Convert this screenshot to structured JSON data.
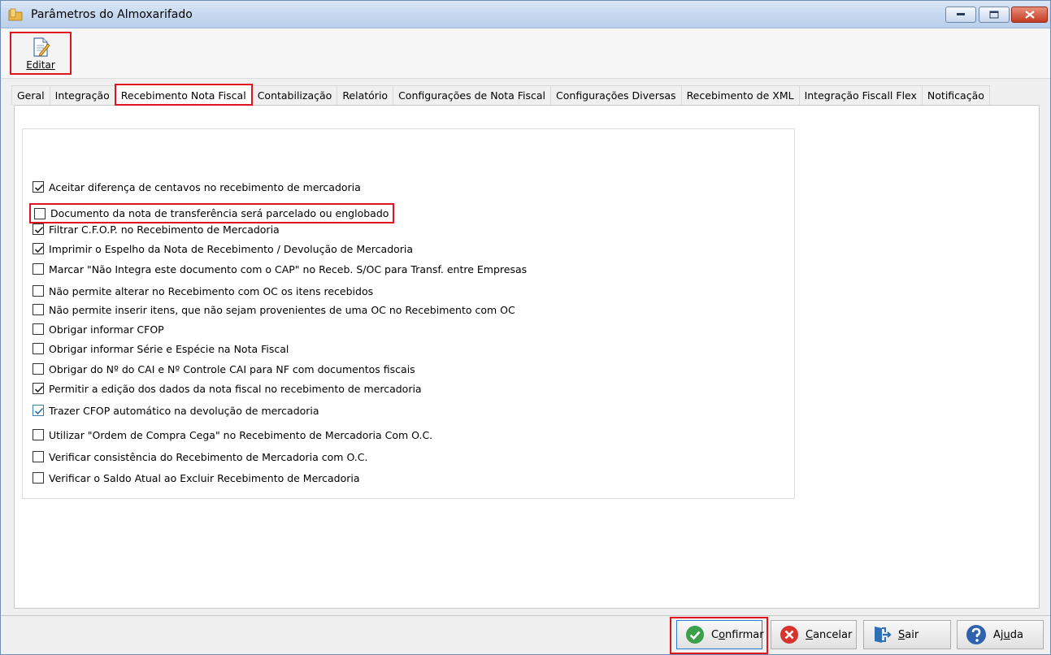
{
  "window": {
    "title": "Parâmetros do Almoxarifado",
    "icon": "folder-icon"
  },
  "toolbar": {
    "edit_label": "Editar",
    "edit_icon": "edit-document-icon"
  },
  "tabs": [
    {
      "label": "Geral",
      "active": false
    },
    {
      "label": "Integração",
      "active": false
    },
    {
      "label": "Recebimento Nota Fiscal",
      "active": true
    },
    {
      "label": "Contabilização",
      "active": false
    },
    {
      "label": "Relatório",
      "active": false
    },
    {
      "label": "Configurações de Nota Fiscal",
      "active": false
    },
    {
      "label": "Configurações Diversas",
      "active": false
    },
    {
      "label": "Recebimento de XML",
      "active": false
    },
    {
      "label": "Integração Fiscall Flex",
      "active": false
    },
    {
      "label": "Notificação",
      "active": false
    }
  ],
  "options": [
    {
      "label": "Aceitar diferença de centavos no recebimento de mercadoria",
      "checked": true
    },
    {
      "label": "Documento da nota de transferência será parcelado ou englobado",
      "checked": false,
      "highlighted": true
    },
    {
      "label": "Filtrar C.F.O.P. no Recebimento de Mercadoria",
      "checked": true
    },
    {
      "label": "Imprimir o Espelho da Nota de Recebimento / Devolução de Mercadoria",
      "checked": true
    },
    {
      "label": "Marcar \"Não Integra este documento com o CAP\" no Receb. S/OC para Transf. entre Empresas",
      "checked": false
    },
    {
      "label": "Não permite alterar no Recebimento com OC os itens recebidos",
      "checked": false
    },
    {
      "label": "Não permite inserir itens, que não sejam provenientes de uma OC no Recebimento com OC",
      "checked": false
    },
    {
      "label": "Obrigar informar CFOP",
      "checked": false
    },
    {
      "label": "Obrigar informar Série e Espécie na Nota Fiscal",
      "checked": false
    },
    {
      "label": "Obrigar do Nº do CAI e Nº Controle CAI para NF com documentos fiscais",
      "checked": false
    },
    {
      "label": "Permitir a edição dos dados da nota fiscal no recebimento de mercadoria",
      "checked": true
    },
    {
      "label": "Trazer CFOP automático na devolução de mercadoria",
      "checked": true,
      "focused": true
    },
    {
      "label": "Utilizar \"Ordem de Compra Cega\" no Recebimento de Mercadoria Com O.C.",
      "checked": false
    },
    {
      "label": "Verificar consistência do Recebimento de Mercadoria com O.C.",
      "checked": false
    },
    {
      "label": "Verificar o Saldo Atual ao Excluir Recebimento de Mercadoria",
      "checked": false
    }
  ],
  "buttons": {
    "confirm": {
      "pre": "C",
      "hot": "o",
      "post": "nfirmar",
      "icon": "check-circle-icon",
      "color": "#3aa04a"
    },
    "cancel": {
      "pre": "",
      "hot": "C",
      "post": "ancelar",
      "icon": "x-circle-icon",
      "color": "#d9342b"
    },
    "exit": {
      "pre": "",
      "hot": "S",
      "post": "air",
      "icon": "exit-door-icon",
      "color": "#2f6fb3"
    },
    "help": {
      "pre": "Aj",
      "hot": "u",
      "post": "da",
      "icon": "help-circle-icon",
      "color": "#2e62b0"
    }
  }
}
